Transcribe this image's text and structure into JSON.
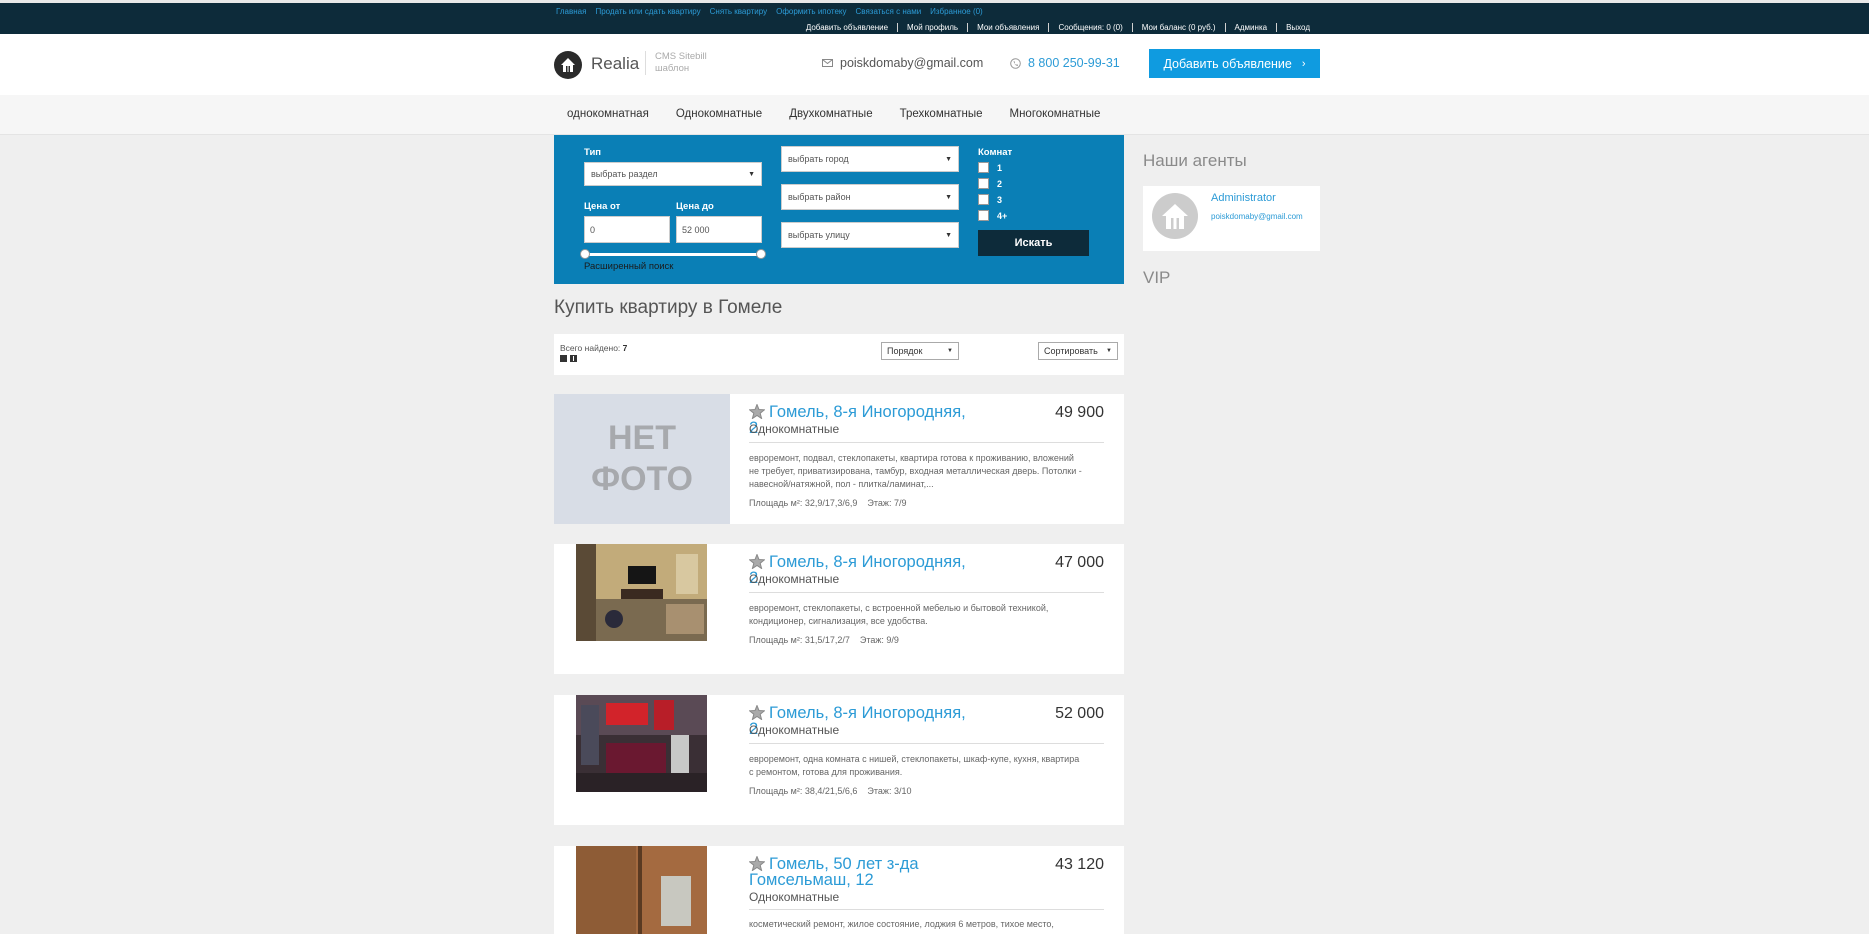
{
  "topnav": {
    "links": [
      "Главная",
      "Продать или сдать квартиру",
      "Снять квартиру",
      "Оформить ипотеку",
      "Связаться с нами",
      "Избранное (0)"
    ],
    "user_links": [
      "Добавить объявление",
      "Мой профиль",
      "Мои объявления",
      "Сообщения: 0 (0)",
      "Мои баланс (0 руб.)",
      "Админка",
      "Выход"
    ]
  },
  "header": {
    "logo_name": "Realia",
    "logo_sub_1": "CMS Sitebill",
    "logo_sub_2": "шаблон",
    "email": "poiskdomaby@gmail.com",
    "phone": "8 800 250-99-31",
    "add_button": "Добавить объявление"
  },
  "categories": [
    "однокомнатная",
    "Однокомнатные",
    "Двухкомнатные",
    "Трехкомнатные",
    "Многокомнатные"
  ],
  "search": {
    "type_label": "Тип",
    "type_value": "выбрать раздел",
    "price_from_label": "Цена от",
    "price_from_value": "0",
    "price_to_label": "Цена до",
    "price_to_value": "52 000",
    "extended_link": "Расширенный поиск",
    "city": "выбрать город",
    "district": "выбрать район",
    "street": "выбрать улицу",
    "rooms_label": "Комнат",
    "rooms": [
      "1",
      "2",
      "3",
      "4+"
    ],
    "submit": "Искать"
  },
  "sidebar": {
    "agents_title": "Наши агенты",
    "agent_name": "Administrator",
    "agent_email": "poiskdomaby@gmail.com",
    "vip_title": "VIP"
  },
  "main": {
    "title": "Купить квартиру в Гомеле",
    "found_label": "Всего найдено: ",
    "found_count": "7",
    "order_select": "Порядок",
    "sort_select": "Сортировать"
  },
  "listings": [
    {
      "title": "Гомель, 8-я Иногородняя, 2",
      "price": "49 900",
      "type": "Однокомнатные",
      "desc": "евроремонт, подвал, стеклопакеты, квартира готова к проживанию, вложений не требует, приватизирована, тамбур, входная металлическая дверь. Потолки - навесной/натяжной, пол - плитка/ламинат,...",
      "area": "Площадь м²: 32,9/17,3/6,9",
      "floor": "Этаж: 7/9",
      "nophoto_1": "НЕТ",
      "nophoto_2": "ФОТО"
    },
    {
      "title": "Гомель, 8-я Иногородняя, 2",
      "price": "47 000",
      "type": "Однокомнатные",
      "desc": "евроремонт, стеклопакеты, с встроенной мебелью и бытовой техникой, кондиционер, сигнализация, все удобства.",
      "area": "Площадь м²: 31,5/17,2/7",
      "floor": "Этаж: 9/9"
    },
    {
      "title": "Гомель, 8-я Иногородняя, 2",
      "price": "52 000",
      "type": "Однокомнатные",
      "desc": "евроремонт, одна комната с нишей, стеклопакеты, шкаф-купе, кухня, квартира с ремонтом, готова для проживания.",
      "area": "Площадь м²: 38,4/21,5/6,6",
      "floor": "Этаж: 3/10"
    },
    {
      "title": "Гомель, 50 лет з-да Гомсельмаш, 12",
      "price": "43 120",
      "type": "Однокомнатные",
      "desc": "косметический ремонт, жилое состояние, лоджия 6 метров, тихое место,"
    }
  ],
  "colors": {
    "topbar": "#0d2b3a",
    "accent": "#0f9be0",
    "link": "#2c9bd6",
    "search_panel": "#0a7fb6"
  }
}
